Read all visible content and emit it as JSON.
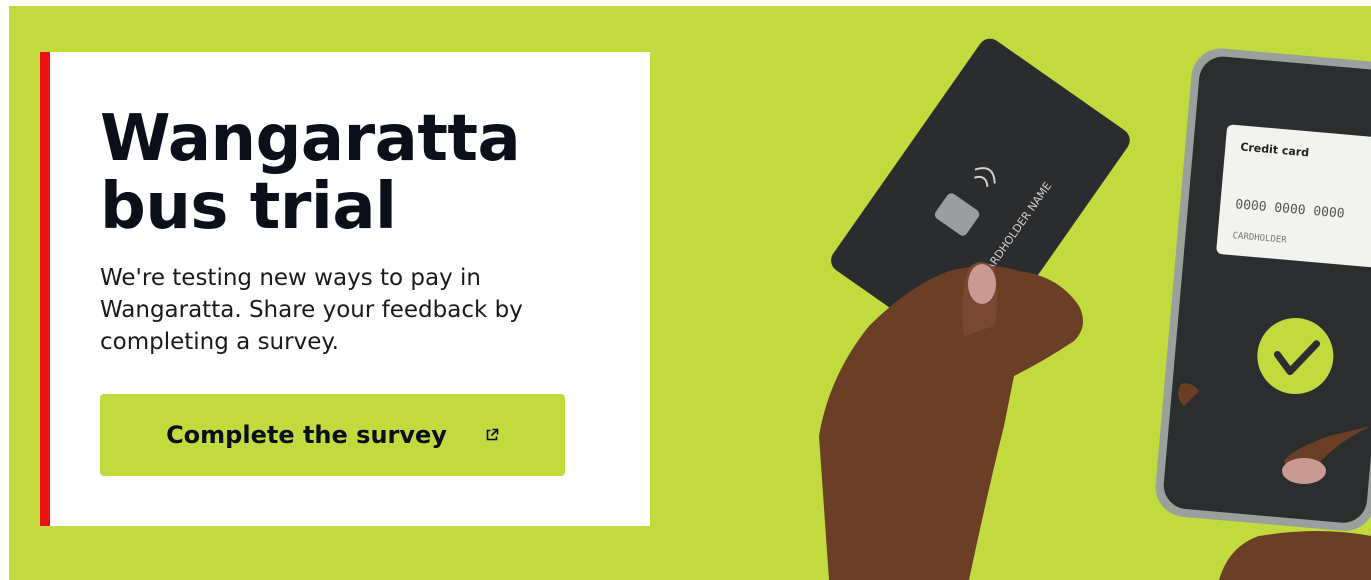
{
  "hero": {
    "title": "Wangaratta bus trial",
    "description": "We're testing new ways to pay in Wangaratta. Share your feedback by completing a survey.",
    "cta_label": "Complete the survey",
    "cta_icon": "external-link-icon"
  },
  "illustration": {
    "card_holder_text": "CARDHOLDER NAME",
    "phone_card_title": "Credit card",
    "phone_card_number": "0000 0000 0000",
    "phone_card_holder": "CARDHOLDER",
    "check_icon": "checkmark-icon"
  },
  "colors": {
    "background": "#c3da3f",
    "accent": "#ee1111",
    "button": "#c3da3f",
    "text": "#0b0f1a"
  }
}
